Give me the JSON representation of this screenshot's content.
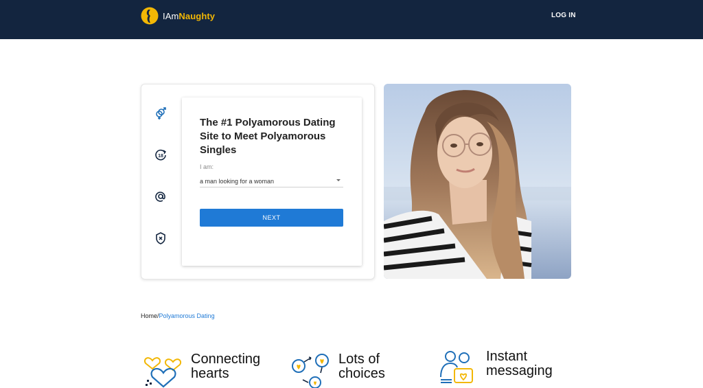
{
  "header": {
    "logo_prefix": "IAm",
    "logo_brand": "Naughty",
    "login_label": "LOG IN"
  },
  "signup": {
    "side_icons": [
      "gender-icon",
      "age-18-icon",
      "email-at-icon",
      "shield-icon"
    ],
    "heading": "The #1 Polyamorous Dating Site to Meet Polyamorous Singles",
    "iam_label": "I am:",
    "iam_value": "a man looking for a woman",
    "next_label": "NEXT"
  },
  "breadcrumb": {
    "home": "Home",
    "separator": "/",
    "current": "Polyamorous Dating"
  },
  "features": [
    {
      "icon": "hearts-icon",
      "line1": "Connecting",
      "line2": "hearts"
    },
    {
      "icon": "choices-icon",
      "line1": "Lots of",
      "line2": "choices"
    },
    {
      "icon": "messaging-icon",
      "line1": "Instant",
      "line2": "messaging"
    }
  ],
  "colors": {
    "header_bg": "#13253f",
    "brand_yellow": "#f2b705",
    "accent_blue": "#1f7ad6"
  }
}
